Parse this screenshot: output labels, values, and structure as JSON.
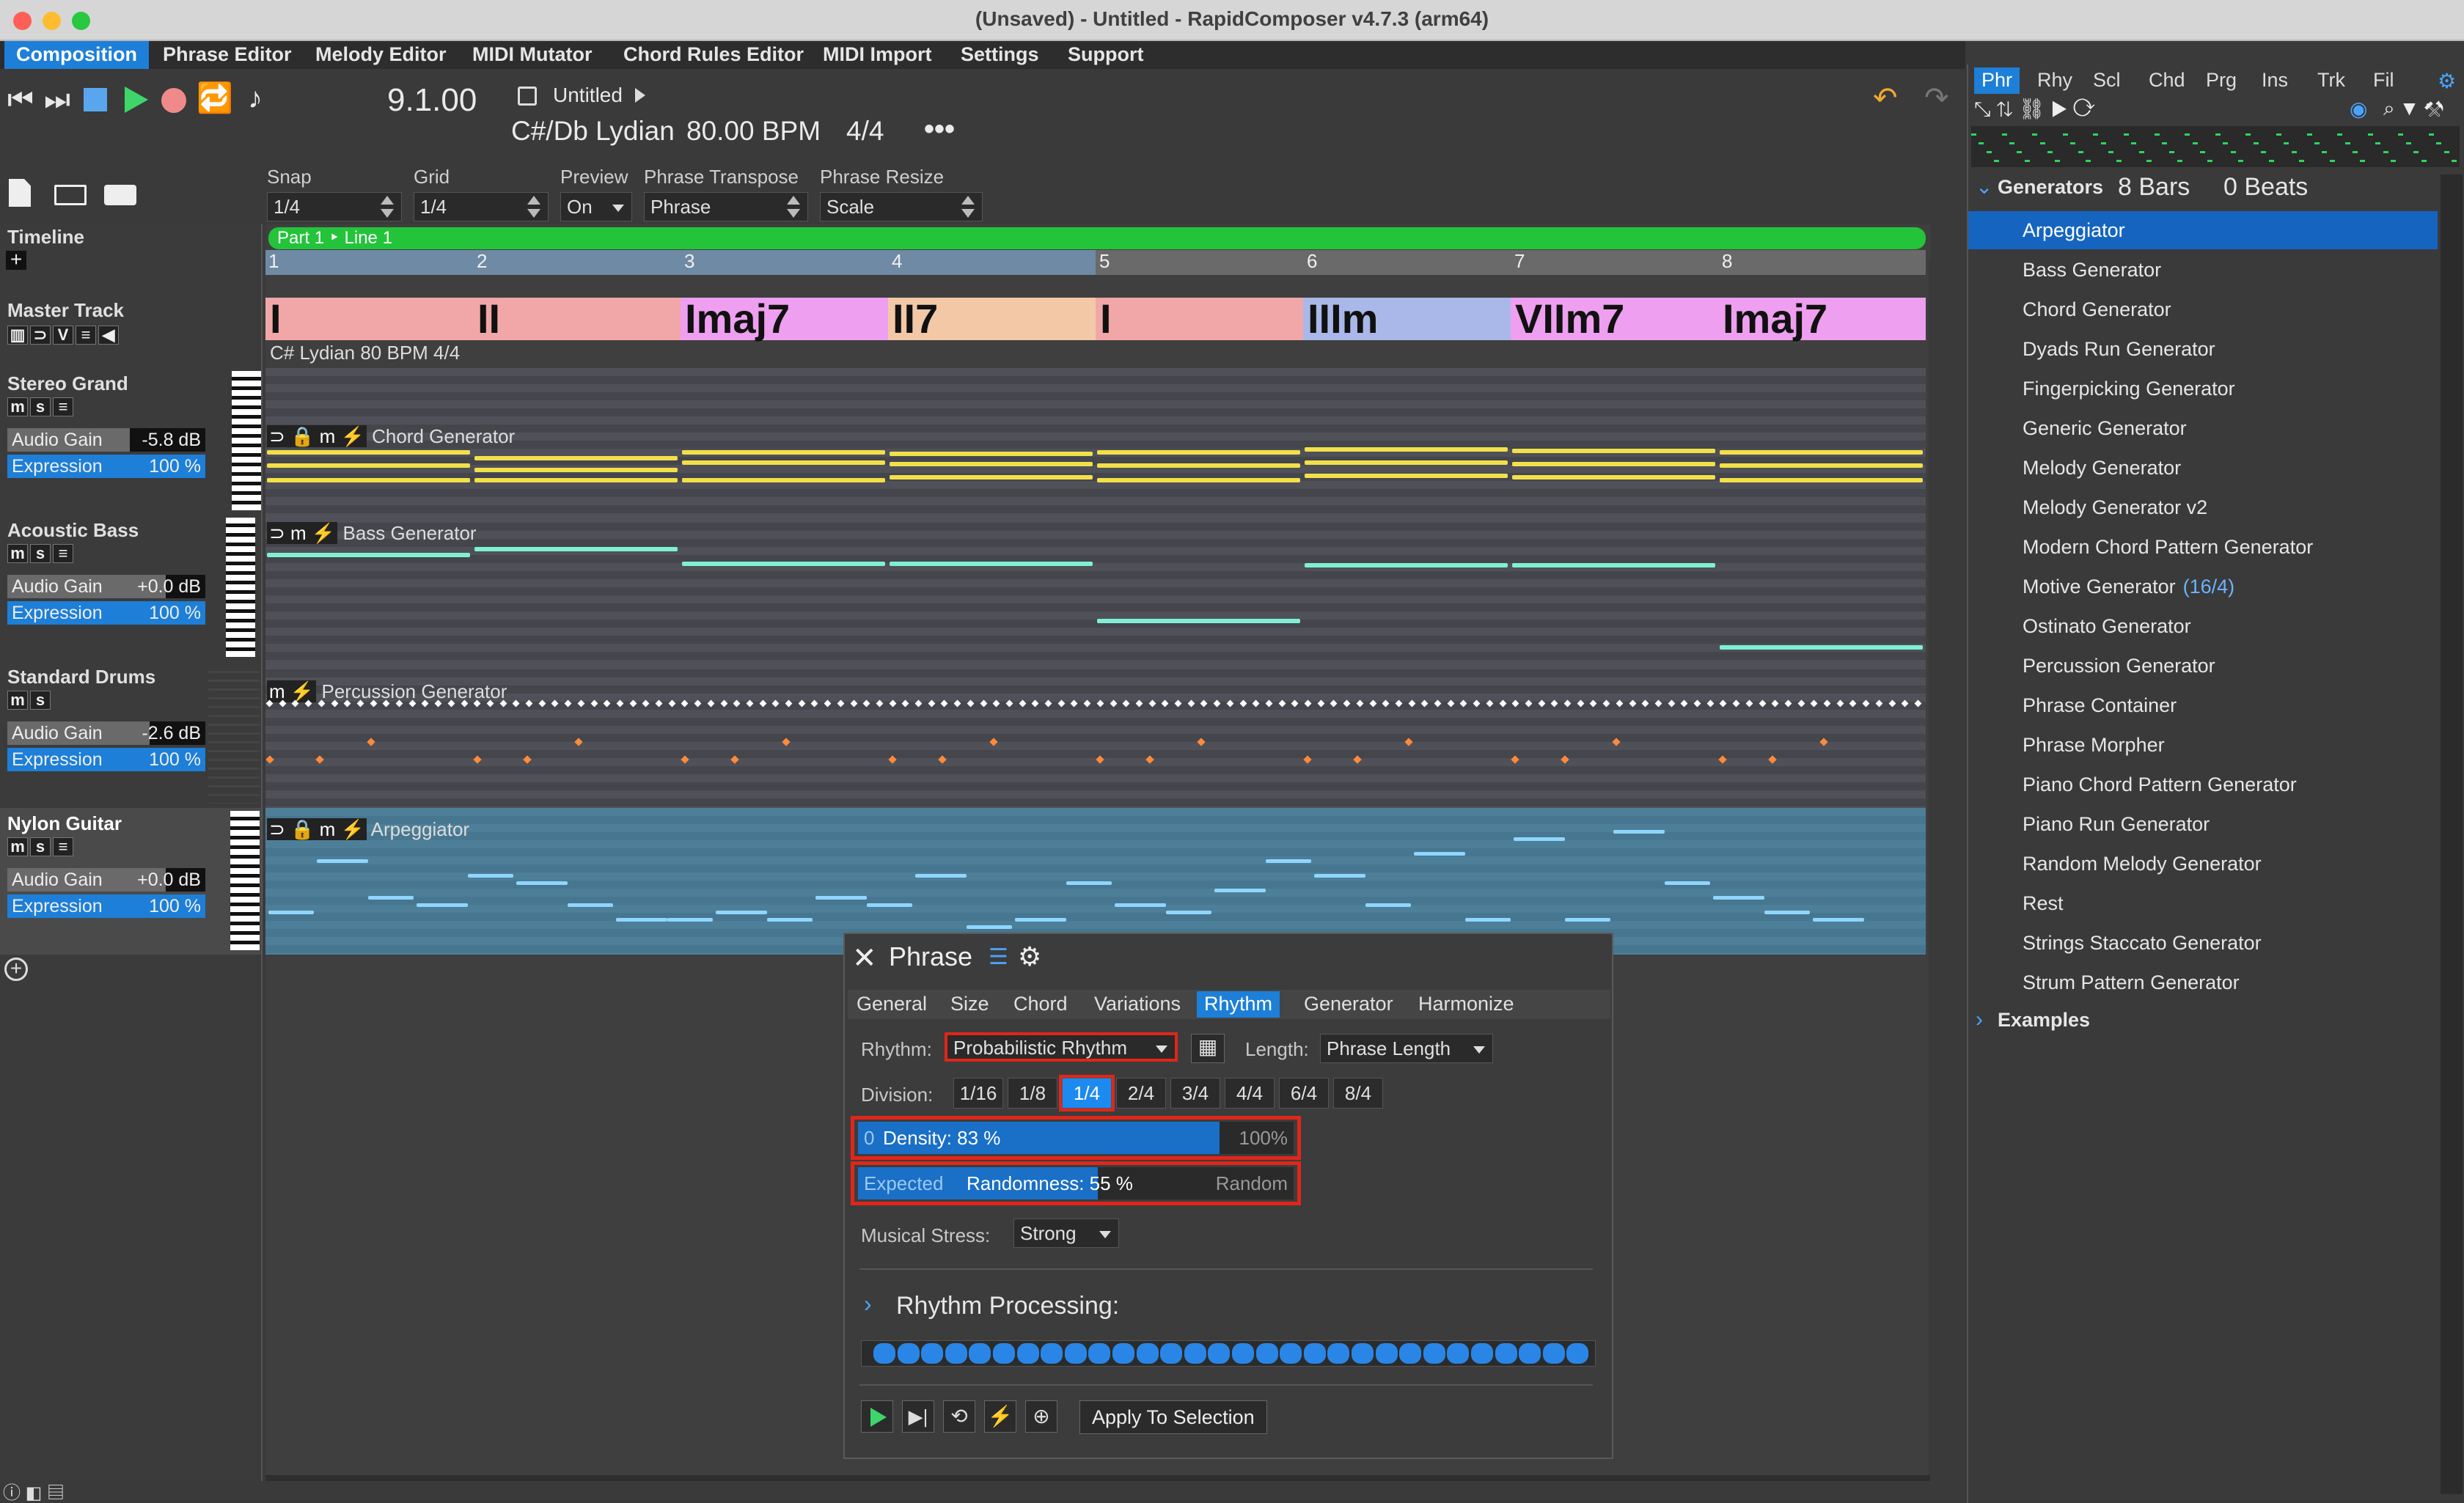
{
  "window": {
    "title": "(Unsaved) - Untitled - RapidComposer v4.7.3 (arm64)"
  },
  "menu": [
    "Composition",
    "Phrase Editor",
    "Melody Editor",
    "MIDI Mutator",
    "Chord Rules Editor",
    "MIDI Import",
    "Settings",
    "Support"
  ],
  "transport": {
    "position": "9.1.00",
    "song_title": "Untitled",
    "key_tempo": "C#/Db Lydian",
    "bpm": "80.00 BPM",
    "meter": "4/4",
    "more": "•••"
  },
  "toolbar": {
    "snap": {
      "label": "Snap",
      "value": "1/4"
    },
    "grid": {
      "label": "Grid",
      "value": "1/4"
    },
    "preview": {
      "label": "Preview",
      "value": "On"
    },
    "transpose": {
      "label": "Phrase Transpose",
      "value": "Phrase"
    },
    "resize": {
      "label": "Phrase Resize",
      "value": "Scale"
    }
  },
  "left": {
    "timeline": "Timeline",
    "master": "Master Track",
    "tracks": [
      {
        "name": "Stereo Grand",
        "gain_label": "Audio Gain",
        "gain": "-5.8 dB",
        "expr_label": "Expression",
        "expr": "100 %",
        "gain_level": 0.62
      },
      {
        "name": "Acoustic Bass",
        "gain_label": "Audio Gain",
        "gain": "+0.0 dB",
        "expr_label": "Expression",
        "expr": "100 %",
        "gain_level": 0.8
      },
      {
        "name": "Standard Drums",
        "gain_label": "Audio Gain",
        "gain": "-2.6 dB",
        "expr_label": "Expression",
        "expr": "100 %",
        "gain_level": 0.72
      },
      {
        "name": "Nylon Guitar",
        "gain_label": "Audio Gain",
        "gain": "+0.0 dB",
        "expr_label": "Expression",
        "expr": "100 %",
        "gain_level": 0.8
      }
    ]
  },
  "arranger": {
    "part": "Part 1 ‣ Line 1",
    "bars": [
      "1",
      "2",
      "3",
      "4",
      "5",
      "6",
      "7",
      "8"
    ],
    "chords": [
      "I",
      "II",
      "Imaj7",
      "II7",
      "I",
      "IIIm",
      "VIIm7",
      "Imaj7"
    ],
    "master_info": "C# Lydian 80 BPM 4/4",
    "lane_labels": [
      "Chord Generator",
      "Bass Generator",
      "Percussion Generator",
      "Arpeggiator"
    ]
  },
  "phrase_panel": {
    "title": "Phrase",
    "tabs": [
      "General",
      "Size",
      "Chord",
      "Variations",
      "Rhythm",
      "Generator",
      "Harmonize"
    ],
    "rhythm_label": "Rhythm:",
    "rhythm_value": "Probabilistic Rhythm",
    "length_label": "Length:",
    "length_value": "Phrase Length",
    "division_label": "Division:",
    "divisions": [
      "1/16",
      "1/8",
      "1/4",
      "2/4",
      "3/4",
      "4/4",
      "6/4",
      "8/4"
    ],
    "density_min": "0",
    "density_text": "Density: 83 %",
    "density_max": "100%",
    "density_value": 0.83,
    "random_left": "Expected",
    "random_text": "Randomness: 55 %",
    "random_right": "Random",
    "random_value": 0.55,
    "stress_label": "Musical Stress:",
    "stress_value": "Strong",
    "processing": "Rhythm Processing:",
    "apply": "Apply To Selection"
  },
  "right": {
    "tabs": [
      "Phr",
      "Rhy",
      "Scl",
      "Chd",
      "Prg",
      "Ins",
      "Trk",
      "Fil"
    ],
    "group": "Generators",
    "bars": "8 Bars",
    "beats": "0 Beats",
    "generators": [
      "Arpeggiator",
      "Bass Generator",
      "Chord Generator",
      "Dyads Run Generator",
      "Fingerpicking Generator",
      "Generic Generator",
      "Melody Generator",
      "Melody Generator v2",
      "Modern Chord Pattern Generator",
      "Motive Generator",
      "Ostinato Generator",
      "Percussion Generator",
      "Phrase Container",
      "Phrase Morpher",
      "Piano Chord Pattern Generator",
      "Piano Run Generator",
      "Random Melody Generator",
      "Rest",
      "Strings Staccato Generator",
      "Strum Pattern Generator"
    ],
    "motive_suffix": "(16/4)",
    "examples": "Examples"
  }
}
